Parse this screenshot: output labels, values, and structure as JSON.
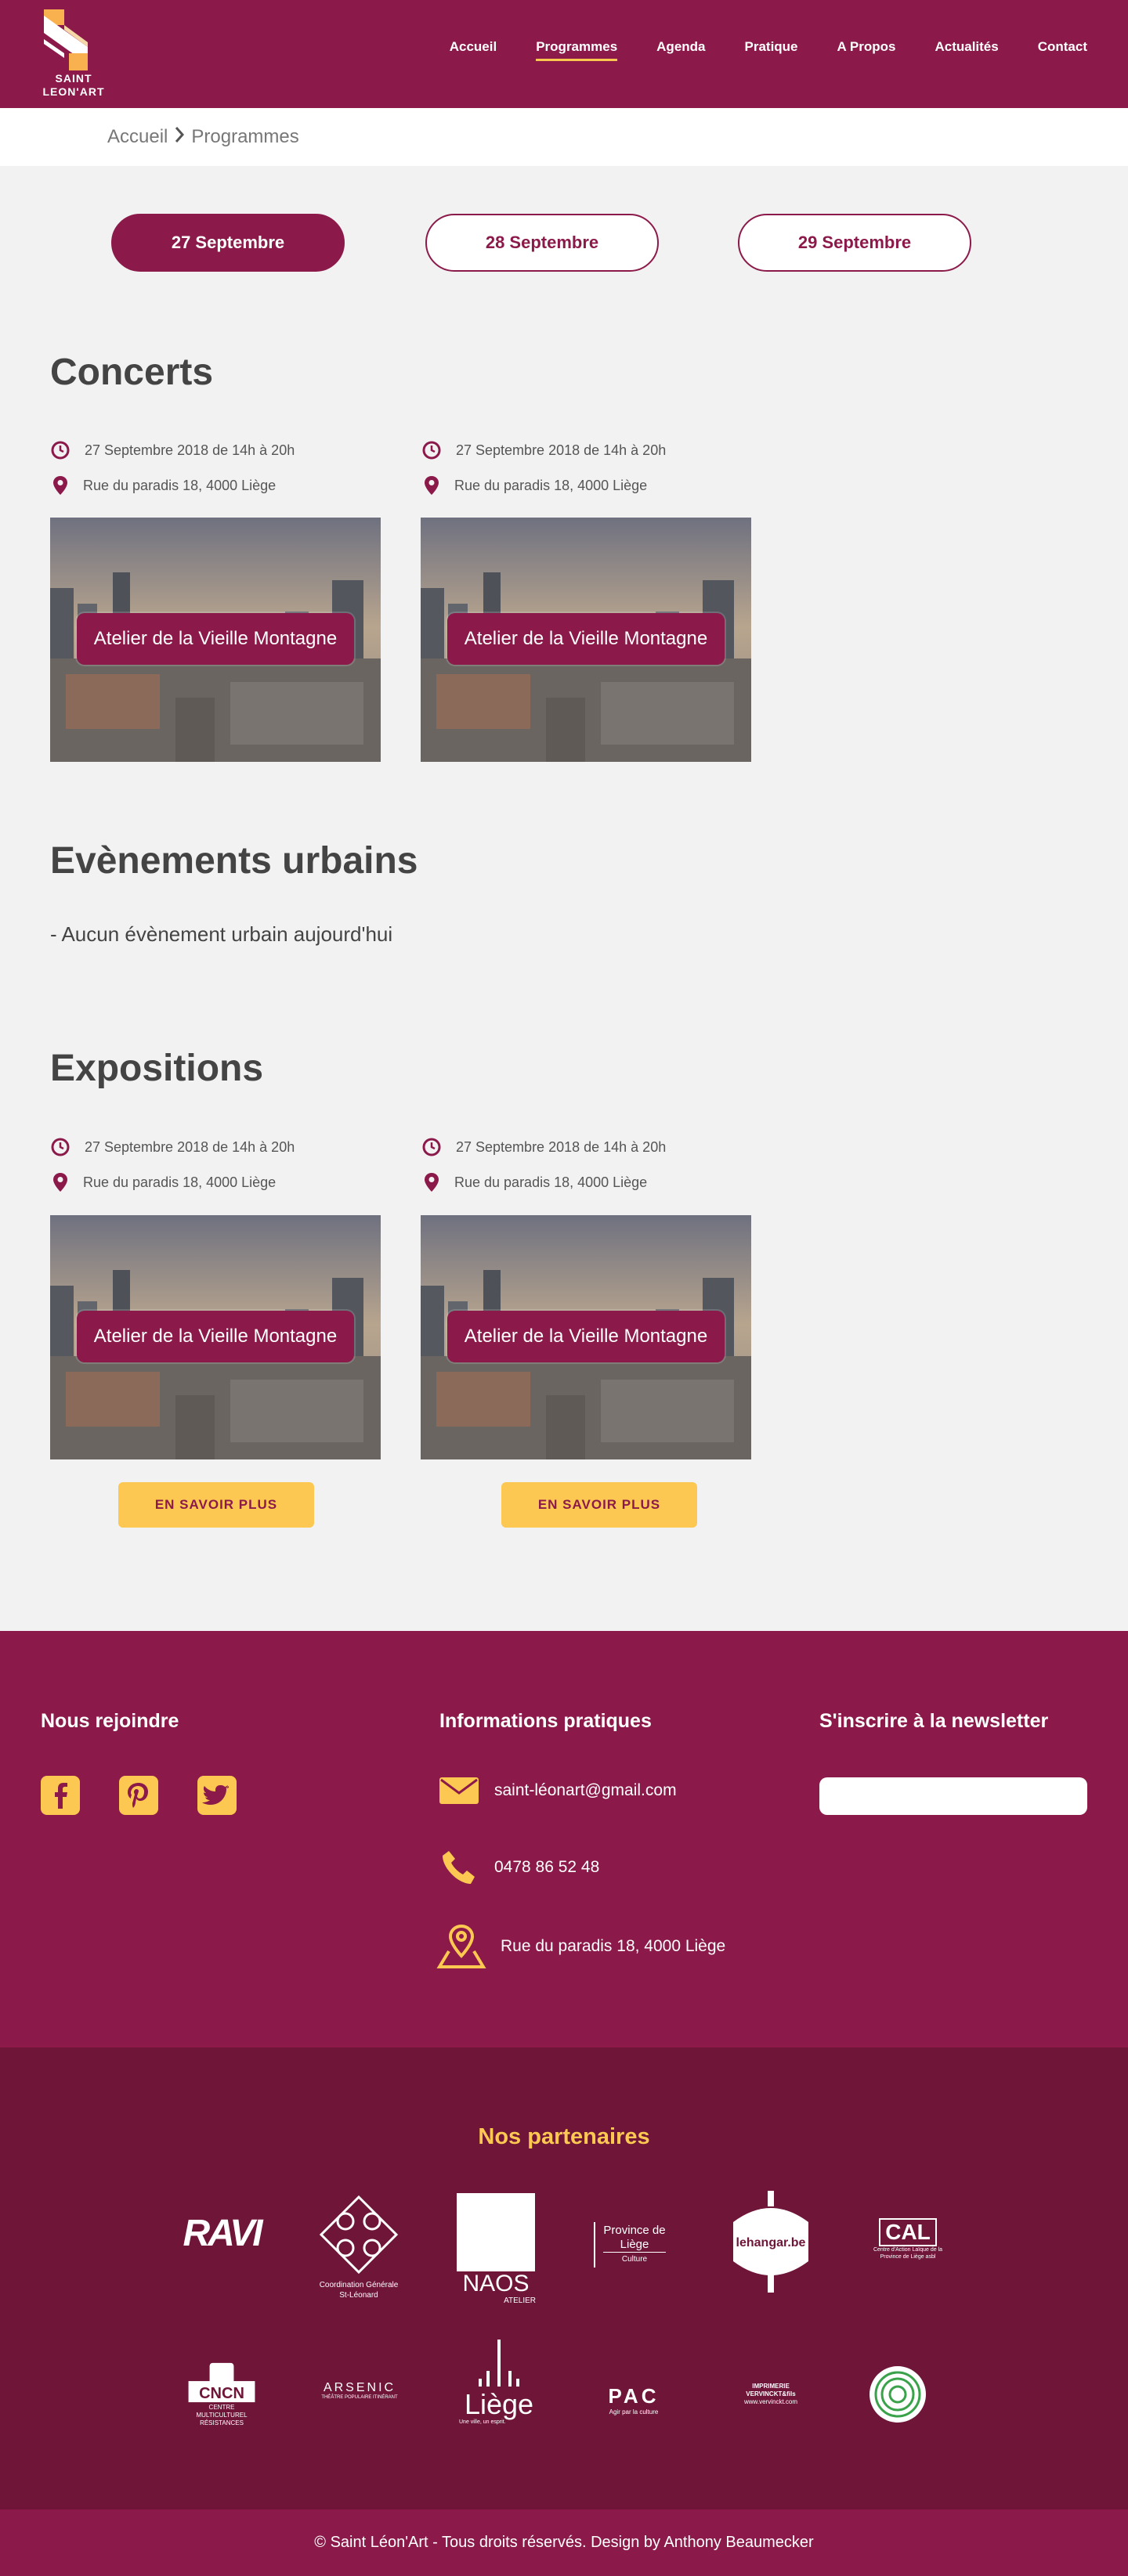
{
  "header": {
    "logo_text_1": "SAINT",
    "logo_text_2": "LEON'ART",
    "nav": [
      "Accueil",
      "Programmes",
      "Agenda",
      "Pratique",
      "A Propos",
      "Actualités",
      "Contact"
    ],
    "active_nav": "Programmes"
  },
  "breadcrumb": {
    "home": "Accueil",
    "current": "Programmes"
  },
  "dates": [
    "27 Septembre",
    "28 Septembre",
    "29 Septembre"
  ],
  "concerts": {
    "title": "Concerts",
    "cards": [
      {
        "time": "27 Septembre 2018 de 14h à 20h",
        "address": "Rue du paradis 18, 4000 Liège",
        "label": "Atelier de la Vieille Montagne"
      },
      {
        "time": "27 Septembre 2018 de 14h à 20h",
        "address": "Rue du paradis 18, 4000 Liège",
        "label": "Atelier de la Vieille Montagne"
      }
    ]
  },
  "urbains": {
    "title": "Evènements urbains",
    "empty": "- Aucun évènement urbain aujourd'hui"
  },
  "expositions": {
    "title": "Expositions",
    "cards": [
      {
        "time": "27 Septembre 2018 de 14h à 20h",
        "address": "Rue du paradis 18, 4000 Liège",
        "label": "Atelier de la Vieille Montagne",
        "button": "EN SAVOIR PLUS"
      },
      {
        "time": "27 Septembre 2018 de 14h à 20h",
        "address": "Rue du paradis 18, 4000 Liège",
        "label": "Atelier de la Vieille Montagne",
        "button": "EN SAVOIR PLUS"
      }
    ]
  },
  "footer": {
    "join_title": "Nous rejoindre",
    "info_title": "Informations pratiques",
    "newsletter_title": "S'inscrire à la newsletter",
    "email": "saint-léonart@gmail.com",
    "phone": "0478 86 52 48",
    "address": "Rue du paradis 18, 4000 Liège",
    "social": [
      "facebook-icon",
      "pinterest-icon",
      "twitter-icon"
    ]
  },
  "partners": {
    "title": "Nos partenaires",
    "row1": [
      "RAVI",
      "Coordination Générale St-Léonard",
      "NAOS",
      "Province de Liège",
      "lehangar.be",
      "CAL"
    ],
    "naos_sub": "ATELIER",
    "province_sub": "Culture",
    "cal_sub": "Centre d'Action Laïque de la Province de Liège asbl",
    "row2": [
      "CNCN",
      "ARSENIC",
      "Liège",
      "PAC",
      "IMPRIMERIE VERVINCKT&fils",
      "vinyl"
    ],
    "cncn_sub": "CENTRE MULTICULTUREL RÉSISTANCES",
    "arsenic_sub": "THÉÂTRE POPULAIRE ITINÉRANT",
    "liege_sub": "Une ville, un esprit.",
    "pac_sub": "Agir par la culture",
    "vervinckt_sub": "www.vervinckt.com"
  },
  "copyright": "© Saint Léon'Art - Tous droits réservés. Design by Anthony Beaumecker",
  "colors": {
    "primary": "#8b1a4a",
    "dark": "#6e1538",
    "accent": "#fcc851",
    "bg": "#f2f2f2"
  }
}
